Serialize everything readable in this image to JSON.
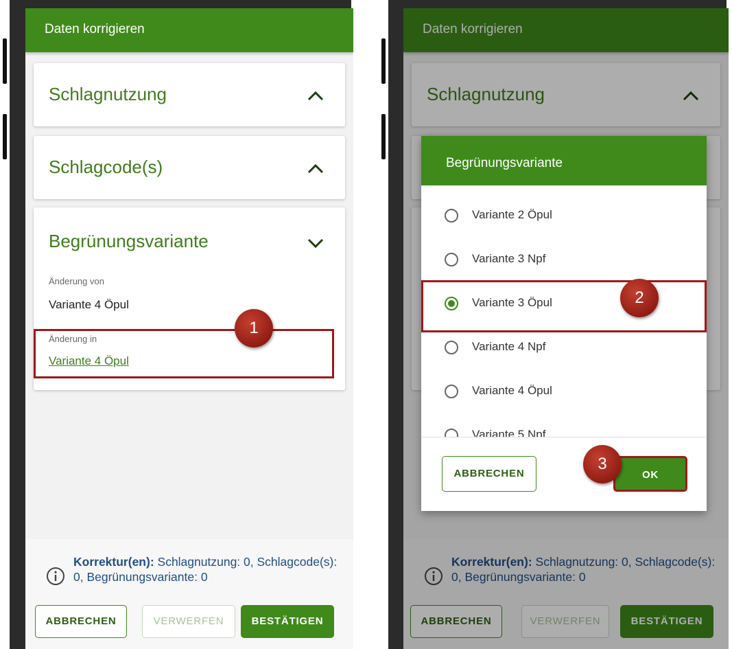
{
  "left": {
    "appbar_title": "Daten korrigieren",
    "cards": [
      {
        "title": "Schlagnutzung",
        "chevron": "chevron-up-icon"
      },
      {
        "title": "Schlagcode(s)",
        "chevron": "chevron-up-icon"
      },
      {
        "title": "Begrünungsvariante",
        "chevron": "chevron-down-icon"
      }
    ],
    "change_from_label": "Änderung von",
    "change_from_value": "Variante 4 Öpul",
    "change_to_label": "Änderung in",
    "change_to_value": "Variante 4 Öpul",
    "step_badge": "1",
    "footer": {
      "info_icon": "info-icon",
      "info_bold": "Korrektur(en):",
      "info_rest": " Schlagnutzung: 0, Schlagcode(s): 0,  Begrünungsvariante: 0",
      "cancel_label": "ABBRECHEN",
      "discard_label": "VERWERFEN",
      "confirm_label": "BESTÄTIGEN"
    }
  },
  "right": {
    "appbar_title": "Daten korrigieren",
    "card_title": "Schlagnutzung",
    "dialog": {
      "title": "Begrünungsvariante",
      "options": [
        {
          "label": "Variante 2 Öpul",
          "selected": false
        },
        {
          "label": "Variante 3 Npf",
          "selected": false
        },
        {
          "label": "Variante 3 Öpul",
          "selected": true
        },
        {
          "label": "Variante 4 Npf",
          "selected": false
        },
        {
          "label": "Variante 4 Öpul",
          "selected": false
        },
        {
          "label": "Variante 5 Npf",
          "selected": false
        }
      ],
      "cancel_label": "ABBRECHEN",
      "ok_label": "OK"
    },
    "step_badge_option": "2",
    "step_badge_ok": "3",
    "footer": {
      "info_bold": "Korrektur(en):",
      "info_rest": " Schlagnutzung: 0, Schlagcode(s): 0,  Begrünungsvariante: 0",
      "cancel_label": "ABBRECHEN",
      "discard_label": "VERWERFEN",
      "confirm_label": "BESTÄTIGEN"
    }
  },
  "colors": {
    "brand_green": "#3f8a1a",
    "highlight_red": "#a01818",
    "info_blue": "#1f4f86"
  }
}
